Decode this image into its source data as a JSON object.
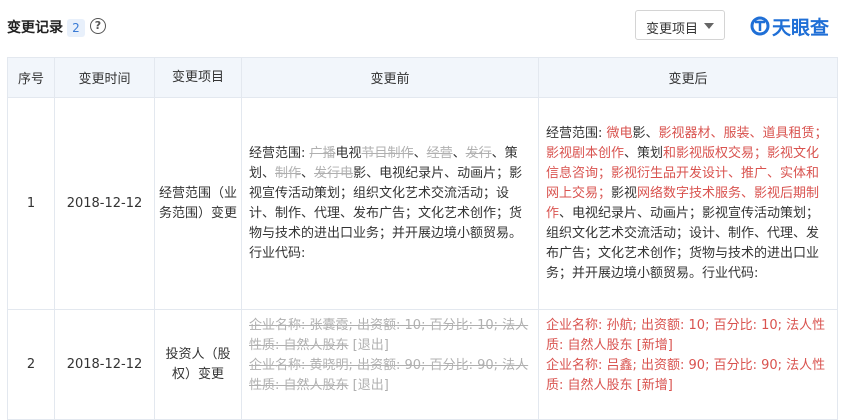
{
  "header": {
    "title": "变更记录",
    "count": "2",
    "help": "?",
    "dropdown_label": "变更项目",
    "logo_text": "天眼查"
  },
  "table": {
    "columns": [
      "序号",
      "变更时间",
      "变更项目",
      "变更前",
      "变更后"
    ],
    "rows": [
      {
        "seq": "1",
        "time": "2018-12-12",
        "item": "经营范围（业务范围）变更",
        "before": [
          {
            "t": "经营范围: ",
            "s": "plain"
          },
          {
            "t": "广播",
            "s": "del"
          },
          {
            "t": "电视",
            "s": "plain"
          },
          {
            "t": "节目制作",
            "s": "del"
          },
          {
            "t": "、",
            "s": "plain"
          },
          {
            "t": "经营",
            "s": "del"
          },
          {
            "t": "、",
            "s": "plain"
          },
          {
            "t": "发行",
            "s": "del"
          },
          {
            "t": "、策划、",
            "s": "plain"
          },
          {
            "t": "制作",
            "s": "del"
          },
          {
            "t": "、",
            "s": "plain"
          },
          {
            "t": "发行电",
            "s": "del"
          },
          {
            "t": "影、电视纪录片、动画片；影视宣传活动策划；组织文化艺术交流活动；设计、制作、代理、发布广告；文化艺术创作；货物与技术的进出口业务；并开展边境小额贸易。行业代码:",
            "s": "plain"
          }
        ],
        "after": [
          {
            "t": "经营范围: ",
            "s": "plain"
          },
          {
            "t": "微电",
            "s": "add"
          },
          {
            "t": "影、",
            "s": "plain"
          },
          {
            "t": "影视器材、服装、道具租赁；影视剧本创作",
            "s": "add"
          },
          {
            "t": "、策划",
            "s": "plain"
          },
          {
            "t": "和影视版权交易；影视文化信息咨询；影视衍生品开发设计、推广、实体和网上交易；",
            "s": "add"
          },
          {
            "t": "影视",
            "s": "plain"
          },
          {
            "t": "网络数字技术服务、影视后期制作",
            "s": "add"
          },
          {
            "t": "、电视纪录片、动画片；影视宣传活动策划；组织文化艺术交流活动；设计、制作、代理、发布广告；文化艺术创作；货物与技术的进出口业务；并开展边境小额贸易。行业代码:",
            "s": "plain"
          }
        ]
      },
      {
        "seq": "2",
        "time": "2018-12-12",
        "item": "投资人（股权）变更",
        "before": [
          {
            "t": "企业名称: 张囊霞; 出资额: 10; 百分比: 10; 法人性质: 自然人股东",
            "s": "del"
          },
          {
            "t": " [退出]",
            "s": "del2"
          },
          {
            "t": "企业名称: 黄晓明; 出资额: 90; 百分比: 90; 法人性质: 自然人股东",
            "s": "del",
            "br": true
          },
          {
            "t": " [退出]",
            "s": "del2"
          }
        ],
        "after": [
          {
            "t": "企业名称: 孙航; 出资额: 10; 百分比: 10; 法人性质: 自然人股东 [新增]",
            "s": "add"
          },
          {
            "t": "企业名称: 吕鑫; 出资额: 90; 百分比: 90; 法人性质: 自然人股东 [新增]",
            "s": "add",
            "br": true
          }
        ]
      }
    ]
  },
  "colors": {
    "added": "#d9534f",
    "removed": "#b0b0b0",
    "header_bg": "#f2f6fb",
    "brand": "#1f6fd6"
  }
}
